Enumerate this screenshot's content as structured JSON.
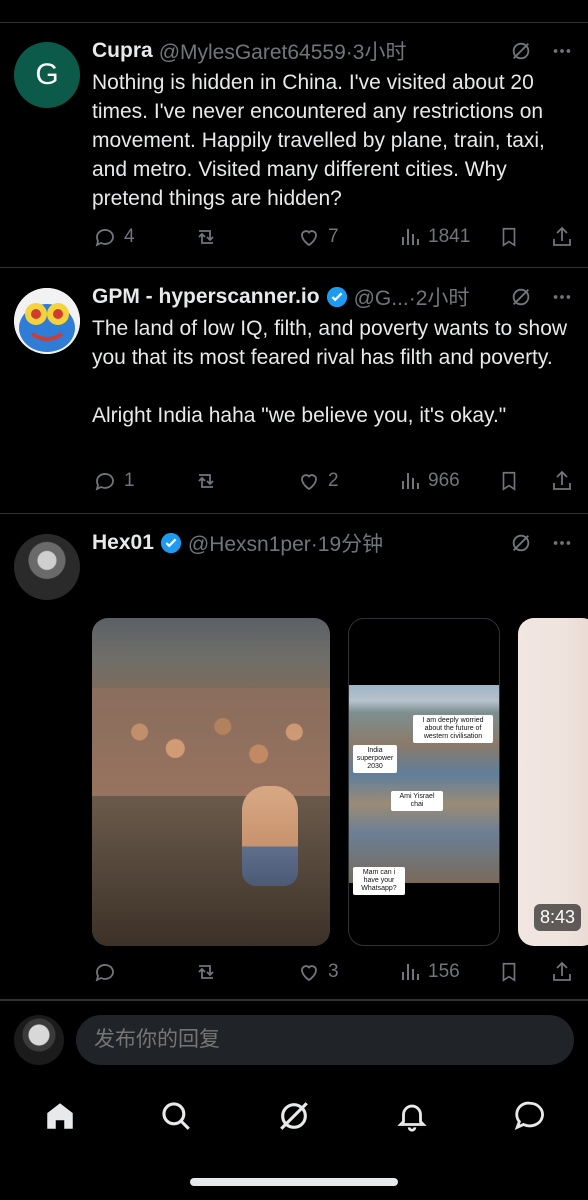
{
  "posts": [
    {
      "avatar_letter": "G",
      "name": "Cupra",
      "handle": "@MylesGaret64559",
      "time": "·3小时",
      "text": "Nothing is hidden in China. I've visited about 20 times. I've never encountered any restrictions on movement. Happily travelled by plane, train, taxi, and metro. Visited many different cities. Why pretend things are hidden?",
      "replies": "4",
      "reposts": "",
      "likes": "7",
      "views": "1841"
    },
    {
      "name": "GPM - hyperscanner.io",
      "handle": "@G...",
      "time": "·2小时",
      "text": "The land of low IQ, filth, and poverty wants to show you that its most feared rival has filth and poverty.\n\nAlright India haha \"we believe you, it's okay.\"",
      "replies": "1",
      "reposts": "",
      "likes": "2",
      "views": "966"
    },
    {
      "name": "Hex01",
      "handle": "@Hexsn1per",
      "time": "·19分钟",
      "replies": "",
      "reposts": "",
      "likes": "3",
      "views": "156",
      "media_captions": [
        "I am deeply worried about the future of western civilisation",
        "India superpower 2030",
        "Ami Yisrael chai",
        "Mam can i have your Whatsapp?"
      ],
      "video_duration": "8:43"
    }
  ],
  "reply_placeholder": "发布你的回复",
  "colors": {
    "background": "#000000",
    "text": "#e7e9ea",
    "secondary": "#71767b",
    "divider": "#2f3336",
    "verified": "#1d9bf0"
  },
  "tabbar": [
    "home-icon",
    "search-icon",
    "grok-icon",
    "notifications-icon",
    "messages-icon"
  ]
}
